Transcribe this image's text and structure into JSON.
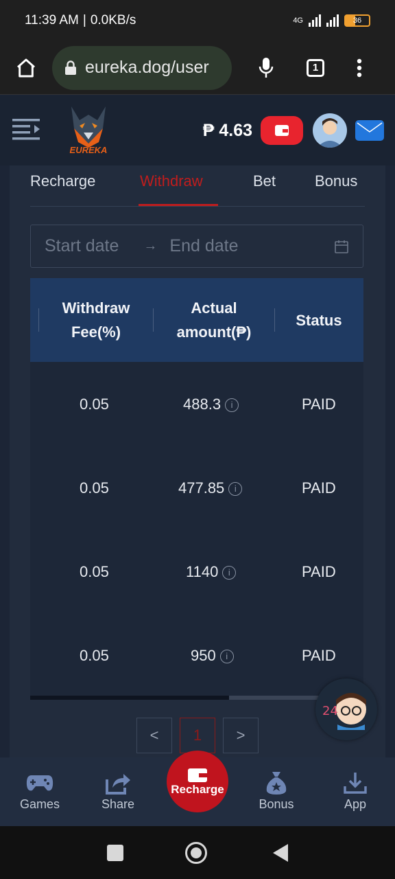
{
  "statusbar": {
    "time": "11:39 AM",
    "speed": "0.0KB/s",
    "network": "4G",
    "battery": "36"
  },
  "browser": {
    "url": "eureka.dog/user",
    "tab_count": "1"
  },
  "header": {
    "logo_text": "EUREKA",
    "balance": "₱ 4.63"
  },
  "tabs": [
    {
      "label": "Recharge"
    },
    {
      "label": "Withdraw"
    },
    {
      "label": "Bet"
    },
    {
      "label": "Bonus"
    }
  ],
  "date_range": {
    "start_placeholder": "Start date",
    "separator": "→",
    "end_placeholder": "End date"
  },
  "table": {
    "headers": {
      "fee": "Withdraw Fee(%)",
      "amount": "Actual amount(₱)",
      "status": "Status"
    },
    "rows": [
      {
        "fee": "0.05",
        "amount": "488.3",
        "status": "PAID"
      },
      {
        "fee": "0.05",
        "amount": "477.85",
        "status": "PAID"
      },
      {
        "fee": "0.05",
        "amount": "1140",
        "status": "PAID"
      },
      {
        "fee": "0.05",
        "amount": "950",
        "status": "PAID"
      }
    ]
  },
  "pagination": {
    "prev": "<",
    "current": "1",
    "next": ">"
  },
  "bottom_nav": [
    {
      "label": "Games"
    },
    {
      "label": "Share"
    },
    {
      "label": "Recharge"
    },
    {
      "label": "Bonus"
    },
    {
      "label": "App"
    }
  ],
  "colors": {
    "accent_red": "#c01d1d",
    "header_blue": "#1f3a62",
    "background": "#1c2536"
  }
}
